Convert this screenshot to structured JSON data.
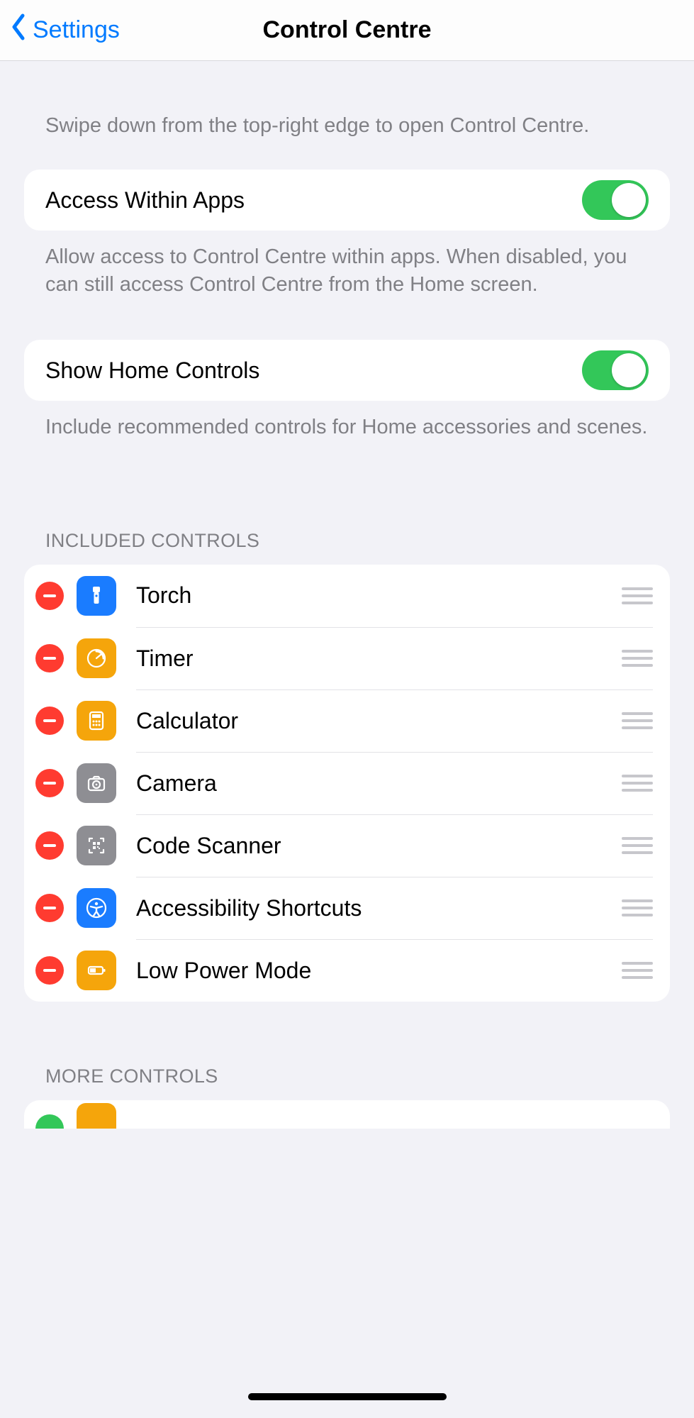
{
  "nav": {
    "back_label": "Settings",
    "title": "Control Centre"
  },
  "intro_hint": "Swipe down from the top-right edge to open Control Centre.",
  "toggles": {
    "access": {
      "label": "Access Within Apps",
      "on": true,
      "footer": "Allow access to Control Centre within apps. When disabled, you can still access Control Centre from the Home screen."
    },
    "home": {
      "label": "Show Home Controls",
      "on": true,
      "footer": "Include recommended controls for Home accessories and scenes."
    }
  },
  "included": {
    "header": "INCLUDED CONTROLS",
    "items": [
      {
        "label": "Torch",
        "icon": "torch",
        "color": "blue"
      },
      {
        "label": "Timer",
        "icon": "timer",
        "color": "orange"
      },
      {
        "label": "Calculator",
        "icon": "calculator",
        "color": "orange"
      },
      {
        "label": "Camera",
        "icon": "camera",
        "color": "grey"
      },
      {
        "label": "Code Scanner",
        "icon": "code-scanner",
        "color": "grey"
      },
      {
        "label": "Accessibility Shortcuts",
        "icon": "accessibility",
        "color": "blue"
      },
      {
        "label": "Low Power Mode",
        "icon": "battery",
        "color": "orange"
      }
    ]
  },
  "more": {
    "header": "MORE CONTROLS"
  }
}
